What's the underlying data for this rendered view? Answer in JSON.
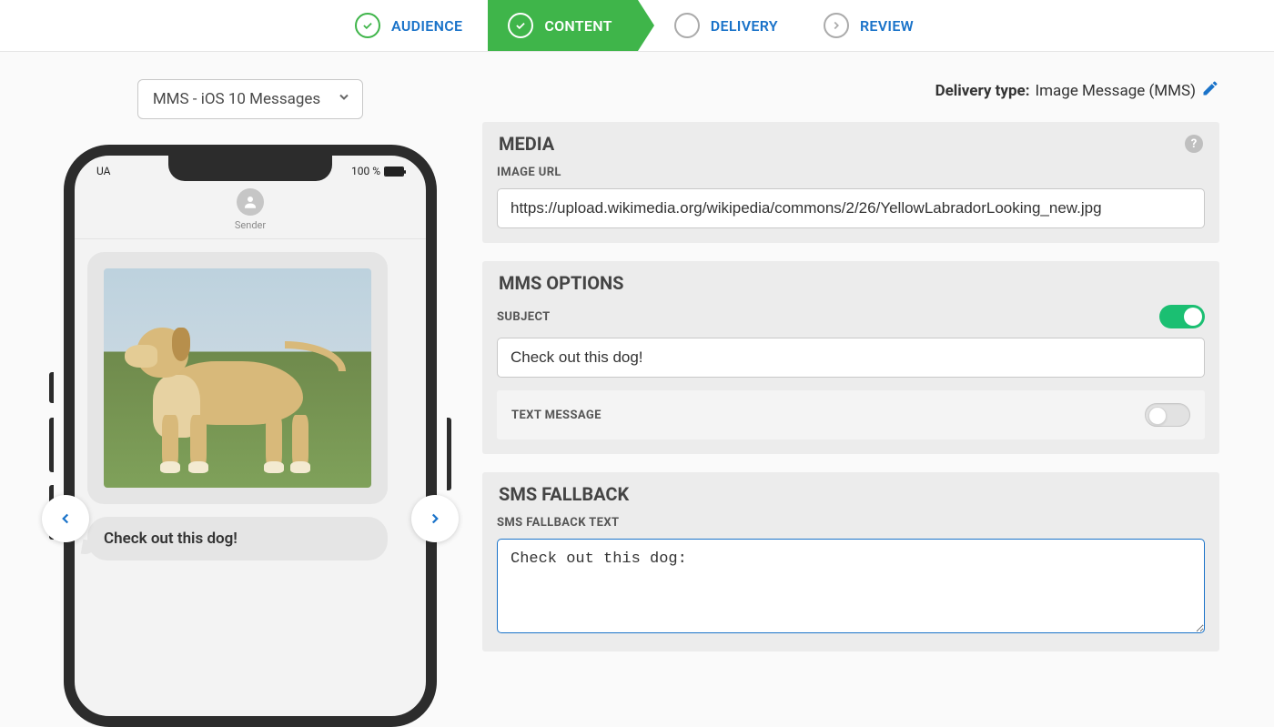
{
  "stepper": {
    "audience": "AUDIENCE",
    "content": "CONTENT",
    "delivery": "DELIVERY",
    "review": "REVIEW"
  },
  "preview": {
    "selector": "MMS - iOS 10 Messages",
    "statusbar_left": "UA",
    "battery_pct": "100 %",
    "sender_label": "Sender",
    "subject_bubble": "Check out this dog!"
  },
  "delivery": {
    "label": "Delivery type:",
    "value": "Image Message (MMS)"
  },
  "media": {
    "title": "MEDIA",
    "image_url_label": "IMAGE URL",
    "image_url_value": "https://upload.wikimedia.org/wikipedia/commons/2/26/YellowLabradorLooking_new.jpg"
  },
  "mms": {
    "title": "MMS OPTIONS",
    "subject_label": "SUBJECT",
    "subject_value": "Check out this dog!",
    "subject_on": true,
    "text_label": "TEXT MESSAGE",
    "text_on": false
  },
  "fallback": {
    "title": "SMS FALLBACK",
    "label": "SMS FALLBACK TEXT",
    "value": "Check out this dog:"
  }
}
